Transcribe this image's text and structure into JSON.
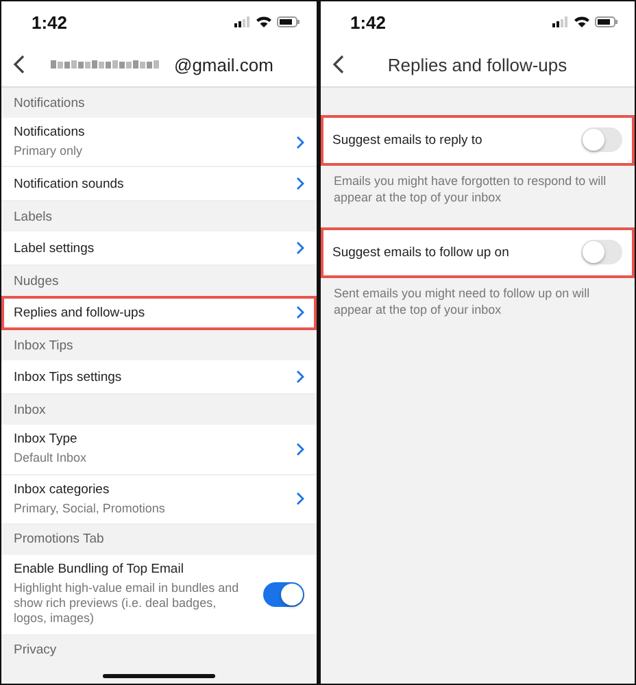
{
  "left": {
    "status": {
      "time": "1:42"
    },
    "header": {
      "email_suffix": "@gmail.com"
    },
    "sections": [
      {
        "title": "Notifications",
        "items": [
          {
            "kind": "link",
            "label": "Notifications",
            "subtitle": "Primary only",
            "highlighted": false
          },
          {
            "kind": "link",
            "label": "Notification sounds",
            "highlighted": false
          }
        ]
      },
      {
        "title": "Labels",
        "items": [
          {
            "kind": "link",
            "label": "Label settings",
            "highlighted": false
          }
        ]
      },
      {
        "title": "Nudges",
        "items": [
          {
            "kind": "link",
            "label": "Replies and follow-ups",
            "highlighted": true
          }
        ]
      },
      {
        "title": "Inbox Tips",
        "items": [
          {
            "kind": "link",
            "label": "Inbox Tips settings",
            "highlighted": false
          }
        ]
      },
      {
        "title": "Inbox",
        "items": [
          {
            "kind": "link",
            "label": "Inbox Type",
            "subtitle": "Default Inbox",
            "highlighted": false
          },
          {
            "kind": "link",
            "label": "Inbox categories",
            "subtitle": "Primary, Social, Promotions",
            "highlighted": false
          }
        ]
      },
      {
        "title": "Promotions Tab",
        "items": [
          {
            "kind": "toggle",
            "label": "Enable Bundling of Top Email",
            "subtitle": "Highlight high-value email in bundles and show rich previews (i.e. deal badges, logos, images)",
            "on": true,
            "highlighted": false
          }
        ]
      },
      {
        "title": "Privacy"
      }
    ]
  },
  "right": {
    "status": {
      "time": "1:42"
    },
    "header": {
      "title": "Replies and follow-ups"
    },
    "settings": [
      {
        "label": "Suggest emails to reply to",
        "on": false,
        "highlighted": true,
        "description": "Emails you might have forgotten to respond to will appear at the top of your inbox"
      },
      {
        "label": "Suggest emails to follow up on",
        "on": false,
        "highlighted": true,
        "description": "Sent emails you might need to follow up on will appear at the top of your inbox"
      }
    ]
  }
}
